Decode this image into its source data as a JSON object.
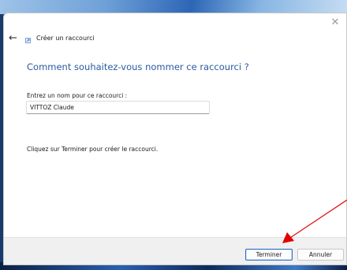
{
  "dialog": {
    "window_title": "Créer un raccourci",
    "heading": "Comment souhaitez-vous nommer ce raccourci ?",
    "field_label": "Entrez un nom pour ce raccourci :",
    "field_value": "VITTOZ Claude",
    "instruction": "Cliquez sur Terminer pour créer le raccourci.",
    "close_glyph": "✕",
    "back_glyph": "←",
    "finish_label": "Terminer",
    "cancel_label": "Annuler"
  },
  "icons": {
    "back": "back-arrow-icon",
    "close": "close-icon",
    "title": "shortcut-icon"
  },
  "colors": {
    "heading": "#2a5aa0",
    "primary_button_border": "#2f6cbf",
    "annotation_arrow": "#e00000"
  }
}
